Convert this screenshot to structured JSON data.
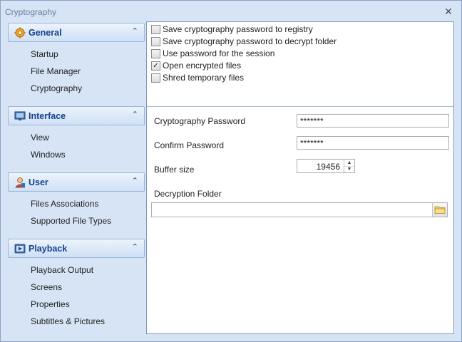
{
  "window": {
    "title": "Cryptography",
    "close_symbol": "✕"
  },
  "sidebar": {
    "groups": [
      {
        "label": "General",
        "icon": "gear-icon",
        "items": [
          "Startup",
          "File Manager",
          "Cryptography"
        ]
      },
      {
        "label": "Interface",
        "icon": "monitor-icon",
        "items": [
          "View",
          "Windows"
        ]
      },
      {
        "label": "User",
        "icon": "user-icon",
        "items": [
          "Files Associations",
          "Supported File Types"
        ]
      },
      {
        "label": "Playback",
        "icon": "playback-icon",
        "items": [
          "Playback Output",
          "Screens",
          "Properties",
          "Subtitles & Pictures"
        ]
      }
    ],
    "chevron": "⌃"
  },
  "options": [
    {
      "label": "Save cryptography password to registry",
      "checked": false
    },
    {
      "label": "Save cryptography password to decrypt folder",
      "checked": false
    },
    {
      "label": "Use password for the session",
      "checked": false
    },
    {
      "label": "Open encrypted files",
      "checked": true
    },
    {
      "label": "Shred temporary files",
      "checked": false
    }
  ],
  "form": {
    "crypto_password_label": "Cryptography Password",
    "crypto_password_value": "*******",
    "confirm_password_label": "Confirm Password",
    "confirm_password_value": "*******",
    "buffer_size_label": "Buffer size",
    "buffer_size_value": "19456",
    "decryption_folder_label": "Decryption Folder",
    "decryption_folder_value": ""
  },
  "colors": {
    "accent": "#15428b",
    "border": "#9bb6d9",
    "window_bg": "#d6e4f5"
  }
}
